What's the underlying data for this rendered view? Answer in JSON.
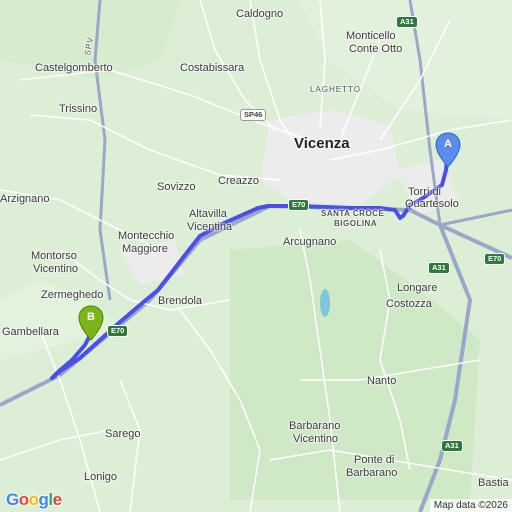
{
  "places": {
    "caldogno": "Caldogno",
    "monticello": "Monticello",
    "conte_otto": "Conte Otto",
    "castelgomberto": "Castelgomberto",
    "costabissara": "Costabissara",
    "laghetto": "LAGHETTO",
    "trissino": "Trissino",
    "vicenza": "Vicenza",
    "sovizzo": "Sovizzo",
    "creazzo": "Creazzo",
    "torri_di": "Torri di",
    "quartesolo": "Quartesolo",
    "arzignano": "Arzignano",
    "altavilla": "Altavilla",
    "vicentina": "Vicentina",
    "santa_croce": "SANTA CROCE",
    "bigolina": "BIGOLINA",
    "montecchio": "Montecchio",
    "maggiore": "Maggiore",
    "arcugnano": "Arcugnano",
    "montorso": "Montorso",
    "montorso_vic": "Vicentino",
    "longare": "Longare",
    "costozza": "Costozza",
    "zermeghedo": "Zermeghedo",
    "brendola": "Brendola",
    "gambellara": "Gambellara",
    "nanto": "Nanto",
    "barbarano": "Barbarano",
    "barbarano_vic": "Vicentino",
    "ponte_di": "Ponte di",
    "ponte_barbarano": "Barbarano",
    "sarego": "Sarego",
    "lonigo": "Lonigo",
    "bastia": "Bastia",
    "spv": "SPV"
  },
  "shields": {
    "a31_top": "A31",
    "sp46": "SP46",
    "e70_center": "E70",
    "e70_right": "E70",
    "a31_right": "A31",
    "e70_left": "E70",
    "a31_bottom": "A31"
  },
  "markers": {
    "start": {
      "label": "A",
      "color": "#5b8def"
    },
    "end": {
      "label": "B",
      "color": "#7cb518"
    }
  },
  "colors": {
    "route": "#4b4ee8",
    "motorway": "#9aa7c9",
    "road": "#ffffff",
    "land": "#dcefd6",
    "urban": "#ececec",
    "lake": "#7cc8d8"
  },
  "footer": {
    "logo": "Google",
    "attribution": "Map data ©2026"
  }
}
